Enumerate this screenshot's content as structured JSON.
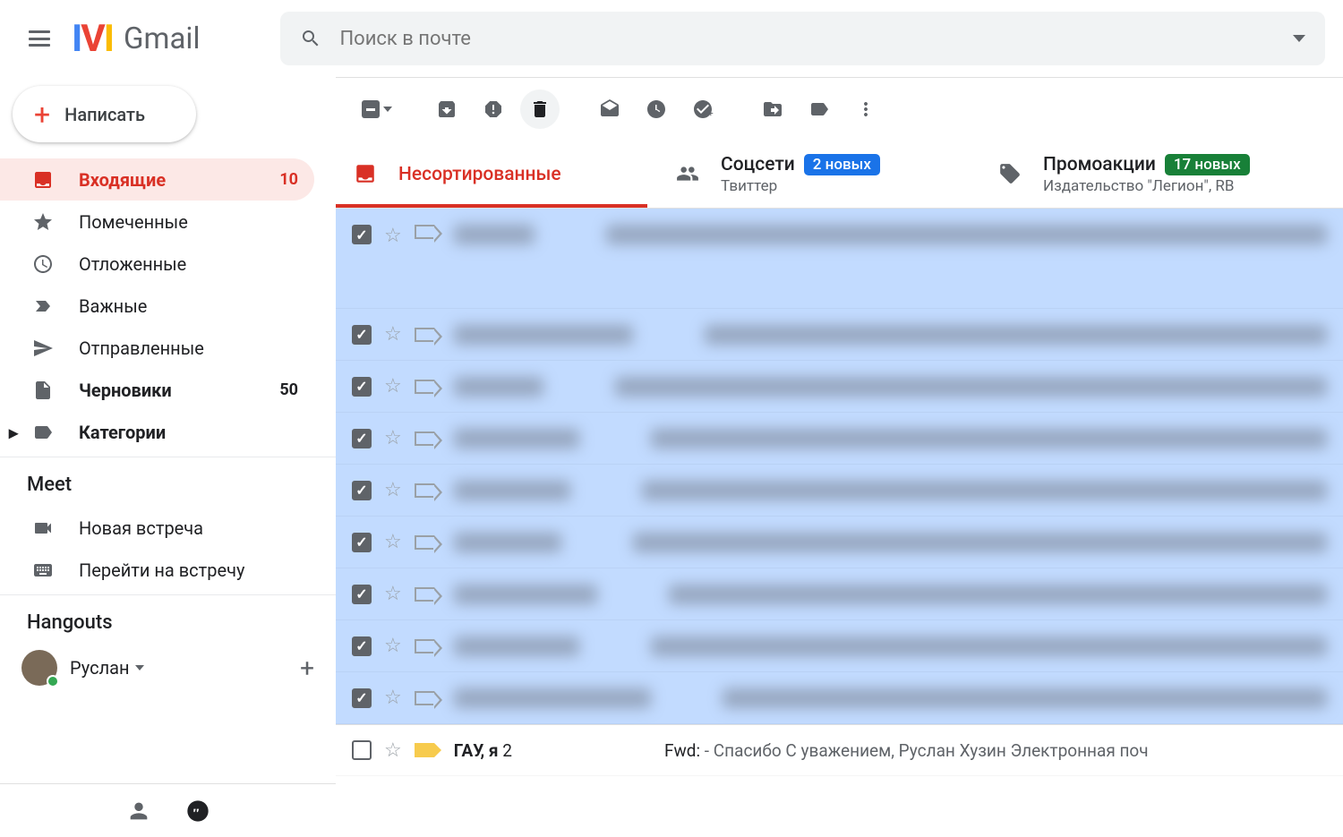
{
  "header": {
    "app_name": "Gmail",
    "search_placeholder": "Поиск в почте"
  },
  "compose_label": "Написать",
  "nav": {
    "inbox": {
      "label": "Входящие",
      "count": "10"
    },
    "starred": {
      "label": "Помеченные"
    },
    "snoozed": {
      "label": "Отложенные"
    },
    "important": {
      "label": "Важные"
    },
    "sent": {
      "label": "Отправленные"
    },
    "drafts": {
      "label": "Черновики",
      "count": "50"
    },
    "categories": {
      "label": "Категории"
    }
  },
  "meet": {
    "title": "Meet",
    "new_meeting": "Новая встреча",
    "join_meeting": "Перейти на встречу"
  },
  "hangouts": {
    "title": "Hangouts",
    "user_name": "Руслан"
  },
  "tabs": {
    "primary": {
      "label": "Несортированные"
    },
    "social": {
      "label": "Соцсети",
      "badge": "2 новых",
      "sub": "Твиттер"
    },
    "promo": {
      "label": "Промоакции",
      "badge": "17 новых",
      "sub": "Издательство \"Легион\", RB"
    }
  },
  "last_row": {
    "sender": "ГАУ, я",
    "count": "2",
    "subject_prefix": "Fwd:",
    "subject_body": " - Спасибо С уважением, Руслан Хузин Электронная поч"
  }
}
